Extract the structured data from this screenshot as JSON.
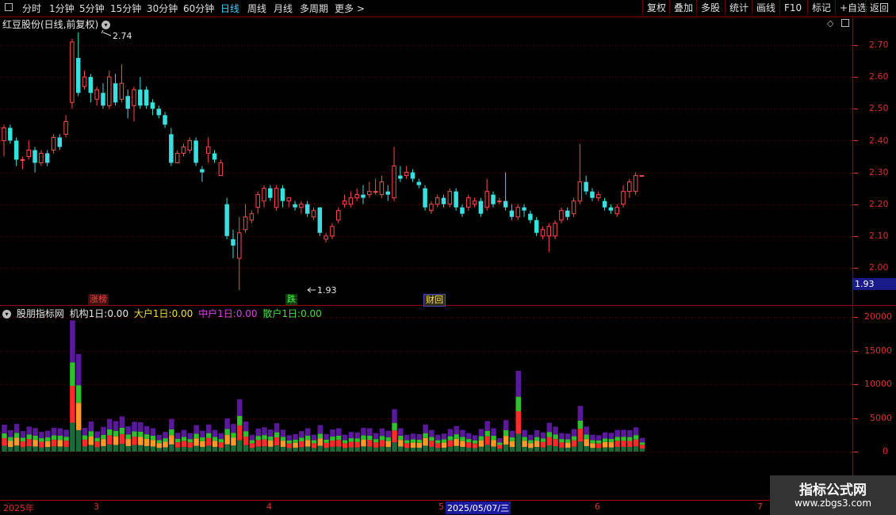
{
  "toolbar": {
    "left": [
      "分时",
      "1分钟",
      "5分钟",
      "15分钟",
      "30分钟",
      "60分钟",
      "日线",
      "周线",
      "月线",
      "多周期",
      "更多 >"
    ],
    "active": "日线",
    "right": [
      "复权",
      "叠加",
      "多股",
      "统计",
      "画线",
      "F10",
      "标记",
      "+自选",
      "返回"
    ]
  },
  "stock": {
    "title": "红豆股份(日线,前复权)",
    "high_label": "2.74",
    "low_label": "1.93",
    "current_price": "1.93"
  },
  "price_axis": [
    "2.70",
    "2.60",
    "2.50",
    "2.40",
    "2.30",
    "2.20",
    "2.10",
    "2.00"
  ],
  "volume_axis": [
    "20000",
    "15000",
    "10000",
    "5000",
    "0"
  ],
  "events": {
    "zhangbang": "涨榜",
    "die": "跌",
    "caihui": "财回"
  },
  "indicator": {
    "name": "股朋指标网",
    "items": [
      {
        "label": "机构1日:",
        "value": "0.00",
        "color": "#e8e8e8"
      },
      {
        "label": "大户1日:",
        "value": "0.00",
        "color": "#f0e040"
      },
      {
        "label": "中户1日:",
        "value": "0.00",
        "color": "#e040e0"
      },
      {
        "label": "散户1日:",
        "value": "0.00",
        "color": "#40e040"
      }
    ]
  },
  "dates": {
    "year": "2025年",
    "m3": "3",
    "m4": "4",
    "m5": "5",
    "selected": "2025/05/07/三",
    "m6": "6",
    "m7": "7"
  },
  "watermark": {
    "title": "指标公式网",
    "url": "www.zbgs3.com"
  },
  "colors": {
    "up": "#ff4a4a",
    "down": "#3ae0e0",
    "grid": "#7a0000",
    "axis": "#e03030",
    "vol_purple": "#5a189a",
    "vol_green": "#2ec02e",
    "vol_orange": "#ff9a2a",
    "vol_red": "#ff2a2a",
    "vol_dgreen": "#1a6a3a"
  },
  "chart_data": {
    "type": "candlestick",
    "title": "红豆股份(日线,前复权)",
    "ylim": [
      1.93,
      2.74
    ],
    "candles": [
      [
        2.4,
        2.44,
        2.45,
        2.35
      ],
      [
        2.44,
        2.4,
        2.45,
        2.39
      ],
      [
        2.4,
        2.34,
        2.41,
        2.32
      ],
      [
        2.34,
        2.34,
        2.35,
        2.31
      ],
      [
        2.35,
        2.37,
        2.4,
        2.34
      ],
      [
        2.37,
        2.33,
        2.38,
        2.3
      ],
      [
        2.33,
        2.36,
        2.37,
        2.32
      ],
      [
        2.36,
        2.33,
        2.37,
        2.32
      ],
      [
        2.37,
        2.41,
        2.42,
        2.36
      ],
      [
        2.41,
        2.38,
        2.42,
        2.37
      ],
      [
        2.42,
        2.46,
        2.48,
        2.41
      ],
      [
        2.52,
        2.71,
        2.72,
        2.5
      ],
      [
        2.66,
        2.55,
        2.74,
        2.54
      ],
      [
        2.57,
        2.6,
        2.62,
        2.56
      ],
      [
        2.6,
        2.55,
        2.61,
        2.52
      ],
      [
        2.53,
        2.56,
        2.57,
        2.51
      ],
      [
        2.55,
        2.51,
        2.58,
        2.5
      ],
      [
        2.51,
        2.6,
        2.62,
        2.5
      ],
      [
        2.58,
        2.52,
        2.61,
        2.51
      ],
      [
        2.53,
        2.58,
        2.64,
        2.52
      ],
      [
        2.54,
        2.5,
        2.56,
        2.47
      ],
      [
        2.51,
        2.56,
        2.57,
        2.46
      ],
      [
        2.56,
        2.51,
        2.6,
        2.5
      ],
      [
        2.56,
        2.51,
        2.57,
        2.5
      ],
      [
        2.52,
        2.5,
        2.53,
        2.48
      ],
      [
        2.5,
        2.48,
        2.51,
        2.47
      ],
      [
        2.48,
        2.45,
        2.49,
        2.44
      ],
      [
        2.42,
        2.33,
        2.44,
        2.32
      ],
      [
        2.33,
        2.36,
        2.37,
        2.34
      ],
      [
        2.36,
        2.38,
        2.39,
        2.35
      ],
      [
        2.37,
        2.4,
        2.41,
        2.36
      ],
      [
        2.4,
        2.33,
        2.41,
        2.32
      ],
      [
        2.31,
        2.3,
        2.32,
        2.27
      ],
      [
        2.36,
        2.38,
        2.41,
        2.33
      ],
      [
        2.36,
        2.34,
        2.37,
        2.33
      ],
      [
        2.29,
        2.33,
        2.34,
        2.29
      ],
      [
        2.2,
        2.1,
        2.22,
        2.09
      ],
      [
        2.09,
        2.07,
        2.12,
        2.03
      ],
      [
        2.03,
        2.11,
        2.16,
        1.93
      ],
      [
        2.12,
        2.16,
        2.2,
        2.11
      ],
      [
        2.15,
        2.17,
        2.18,
        2.14
      ],
      [
        2.19,
        2.23,
        2.24,
        2.17
      ],
      [
        2.21,
        2.25,
        2.26,
        2.19
      ],
      [
        2.25,
        2.22,
        2.26,
        2.21
      ],
      [
        2.19,
        2.25,
        2.26,
        2.18
      ],
      [
        2.25,
        2.21,
        2.26,
        2.19
      ],
      [
        2.21,
        2.22,
        2.22,
        2.19
      ],
      [
        2.2,
        2.19,
        2.21,
        2.18
      ],
      [
        2.19,
        2.2,
        2.21,
        2.17
      ],
      [
        2.2,
        2.17,
        2.21,
        2.16
      ],
      [
        2.16,
        2.18,
        2.19,
        2.15
      ],
      [
        2.19,
        2.11,
        2.19,
        2.1
      ],
      [
        2.09,
        2.1,
        2.11,
        2.08
      ],
      [
        2.1,
        2.13,
        2.14,
        2.09
      ],
      [
        2.15,
        2.18,
        2.19,
        2.14
      ],
      [
        2.2,
        2.21,
        2.23,
        2.19
      ],
      [
        2.2,
        2.22,
        2.24,
        2.19
      ],
      [
        2.22,
        2.23,
        2.25,
        2.21
      ],
      [
        2.23,
        2.22,
        2.26,
        2.2
      ],
      [
        2.23,
        2.24,
        2.27,
        2.22
      ],
      [
        2.24,
        2.24,
        2.28,
        2.23
      ],
      [
        2.23,
        2.27,
        2.29,
        2.22
      ],
      [
        2.24,
        2.23,
        2.26,
        2.21
      ],
      [
        2.22,
        2.32,
        2.38,
        2.21
      ],
      [
        2.29,
        2.28,
        2.32,
        2.27
      ],
      [
        2.29,
        2.3,
        2.32,
        2.28
      ],
      [
        2.3,
        2.28,
        2.31,
        2.27
      ],
      [
        2.27,
        2.26,
        2.28,
        2.25
      ],
      [
        2.25,
        2.19,
        2.26,
        2.18
      ],
      [
        2.18,
        2.2,
        2.21,
        2.17
      ],
      [
        2.2,
        2.22,
        2.23,
        2.19
      ],
      [
        2.22,
        2.2,
        2.23,
        2.19
      ],
      [
        2.2,
        2.24,
        2.25,
        2.19
      ],
      [
        2.24,
        2.19,
        2.25,
        2.18
      ],
      [
        2.19,
        2.17,
        2.2,
        2.16
      ],
      [
        2.19,
        2.22,
        2.23,
        2.18
      ],
      [
        2.2,
        2.21,
        2.22,
        2.19
      ],
      [
        2.21,
        2.17,
        2.22,
        2.16
      ],
      [
        2.19,
        2.24,
        2.28,
        2.18
      ],
      [
        2.23,
        2.2,
        2.24,
        2.19
      ],
      [
        2.21,
        2.21,
        2.22,
        2.2
      ],
      [
        2.21,
        2.19,
        2.3,
        2.18
      ],
      [
        2.18,
        2.16,
        2.2,
        2.15
      ],
      [
        2.16,
        2.19,
        2.2,
        2.15
      ],
      [
        2.19,
        2.18,
        2.2,
        2.16
      ],
      [
        2.17,
        2.15,
        2.18,
        2.14
      ],
      [
        2.15,
        2.11,
        2.16,
        2.1
      ],
      [
        2.1,
        2.12,
        2.13,
        2.09
      ],
      [
        2.1,
        2.13,
        2.14,
        2.05
      ],
      [
        2.1,
        2.14,
        2.15,
        2.09
      ],
      [
        2.15,
        2.18,
        2.19,
        2.14
      ],
      [
        2.18,
        2.16,
        2.19,
        2.15
      ],
      [
        2.17,
        2.21,
        2.22,
        2.16
      ],
      [
        2.21,
        2.27,
        2.39,
        2.2
      ],
      [
        2.27,
        2.24,
        2.29,
        2.23
      ],
      [
        2.24,
        2.22,
        2.25,
        2.21
      ],
      [
        2.22,
        2.23,
        2.24,
        2.21
      ],
      [
        2.21,
        2.19,
        2.22,
        2.18
      ],
      [
        2.19,
        2.18,
        2.2,
        2.17
      ],
      [
        2.17,
        2.19,
        2.2,
        2.16
      ],
      [
        2.2,
        2.24,
        2.26,
        2.19
      ],
      [
        2.24,
        2.27,
        2.28,
        2.22
      ],
      [
        2.24,
        2.29,
        2.3,
        2.23
      ],
      [
        2.29,
        2.29,
        2.29,
        2.29
      ]
    ]
  }
}
